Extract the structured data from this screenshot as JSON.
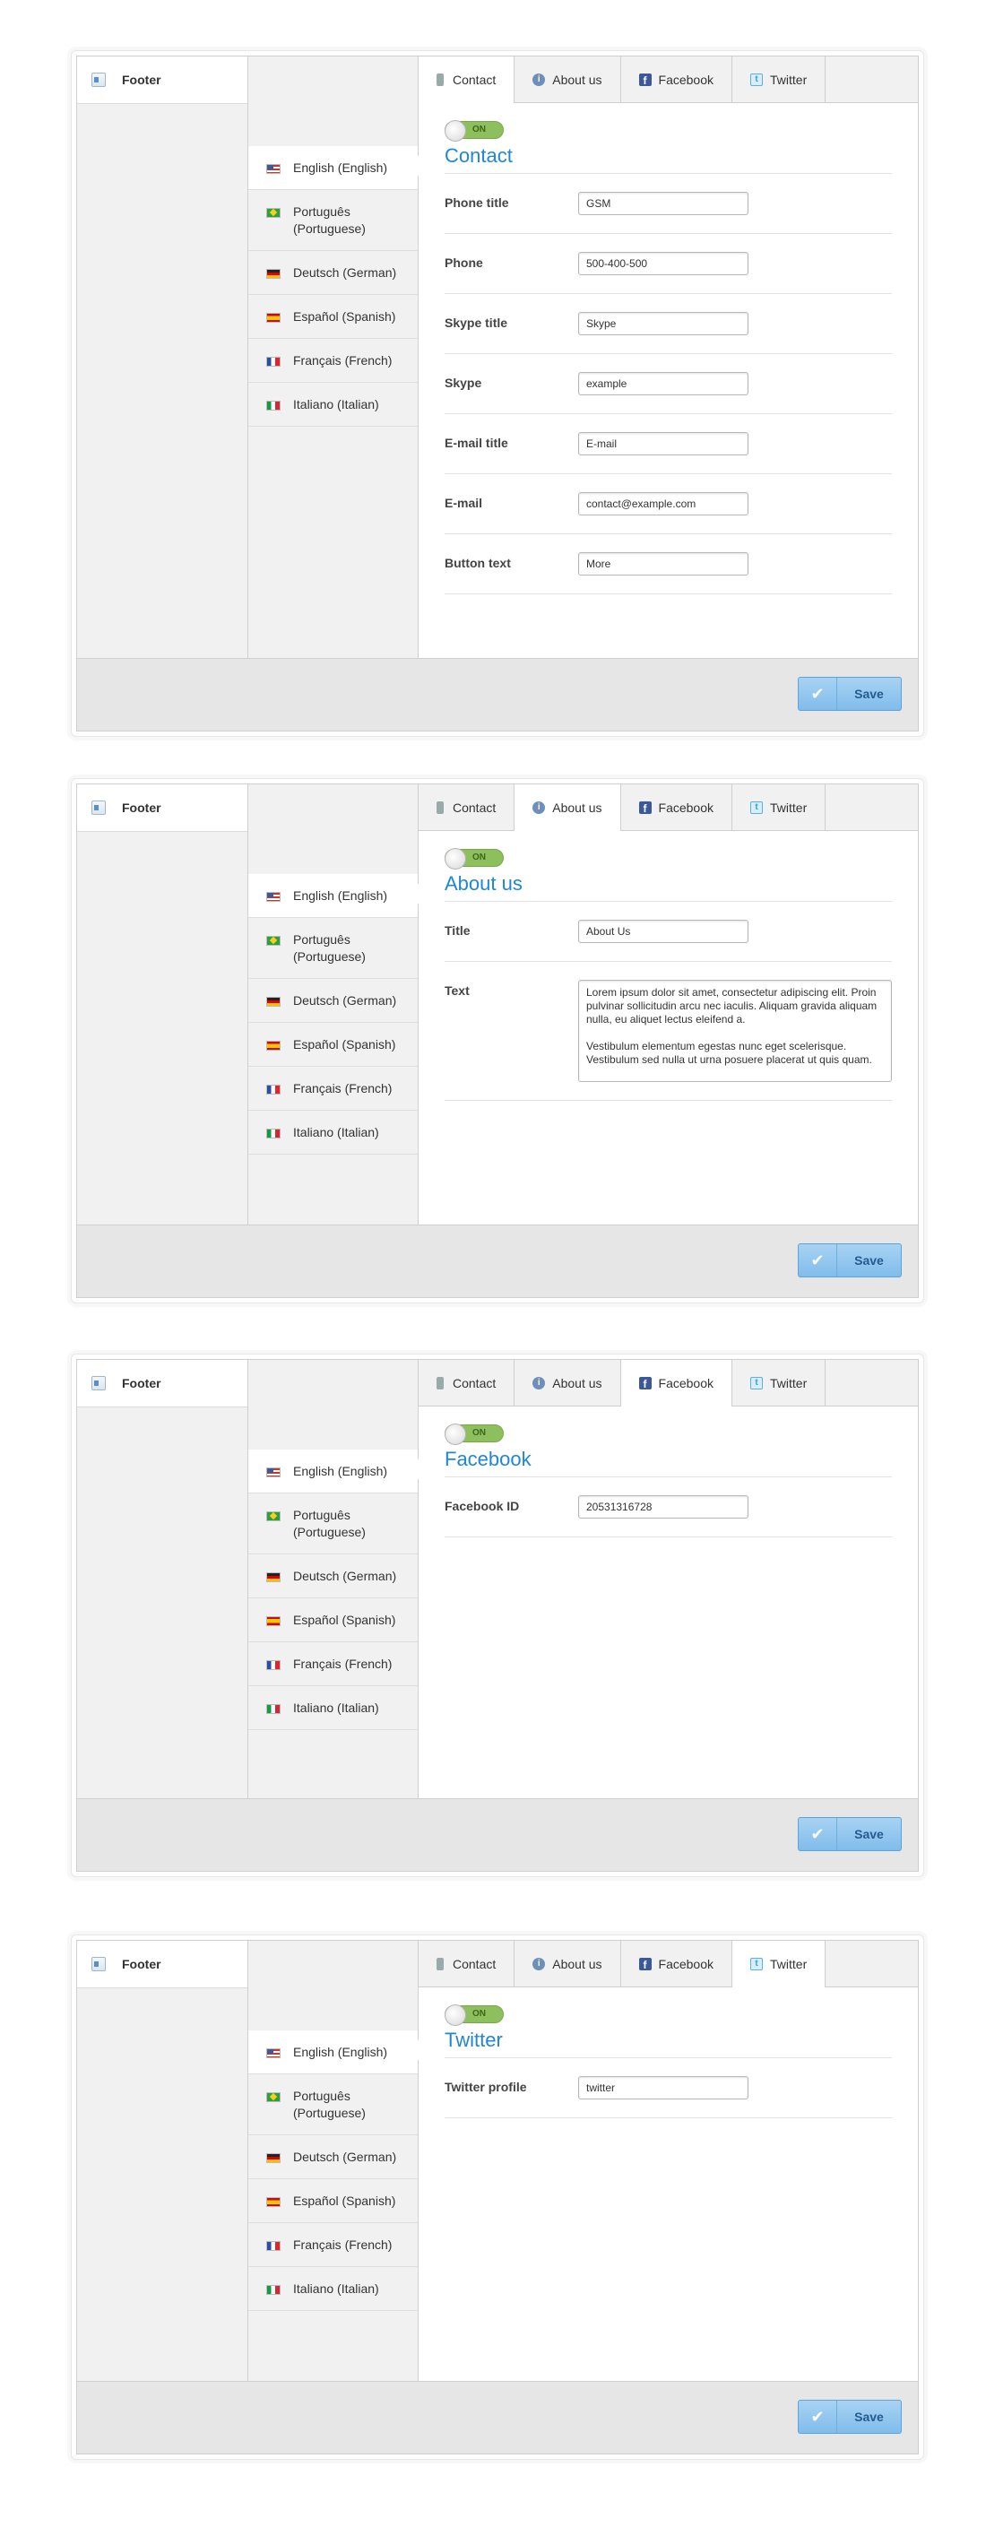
{
  "section": {
    "label": "Footer",
    "icon": "footer-module-icon"
  },
  "languages": [
    {
      "label": "English (English)",
      "flag": "flag-us"
    },
    {
      "label": "Português (Portuguese)",
      "flag": "flag-br"
    },
    {
      "label": "Deutsch (German)",
      "flag": "flag-de"
    },
    {
      "label": "Español (Spanish)",
      "flag": "flag-es"
    },
    {
      "label": "Français (French)",
      "flag": "flag-fr"
    },
    {
      "label": "Italiano (Italian)",
      "flag": "flag-it"
    }
  ],
  "tabs": [
    {
      "label": "Contact",
      "icon": "phone-icon"
    },
    {
      "label": "About us",
      "icon": "info-icon"
    },
    {
      "label": "Facebook",
      "icon": "facebook-icon"
    },
    {
      "label": "Twitter",
      "icon": "twitter-icon"
    }
  ],
  "toggle_label": "ON",
  "save_label": "Save",
  "panels": [
    {
      "active_tab": 0,
      "title": "Contact",
      "fields": [
        {
          "label": "Phone title",
          "value": "GSM"
        },
        {
          "label": "Phone",
          "value": "500-400-500"
        },
        {
          "label": "Skype title",
          "value": "Skype"
        },
        {
          "label": "Skype",
          "value": "example"
        },
        {
          "label": "E-mail title",
          "value": "E-mail"
        },
        {
          "label": "E-mail",
          "value": "contact@example.com"
        },
        {
          "label": "Button text",
          "value": "More"
        }
      ]
    },
    {
      "active_tab": 1,
      "title": "About us",
      "fields": [
        {
          "label": "Title",
          "value": "About Us"
        },
        {
          "label": "Text",
          "type": "textarea",
          "value": "Lorem ipsum dolor sit amet, consectetur adipiscing elit. Proin pulvinar sollicitudin arcu nec iaculis. Aliquam gravida aliquam nulla, eu aliquet lectus eleifend a.\n\nVestibulum elementum egestas nunc eget scelerisque. Vestibulum sed nulla ut urna posuere placerat ut quis quam."
        }
      ]
    },
    {
      "active_tab": 2,
      "title": "Facebook",
      "fields": [
        {
          "label": "Facebook ID",
          "value": "20531316728"
        }
      ]
    },
    {
      "active_tab": 3,
      "title": "Twitter",
      "fields": [
        {
          "label": "Twitter profile",
          "value": "twitter"
        }
      ]
    }
  ],
  "colors": {
    "accent": "#1f86d9",
    "toggle_on": "#8dbf5c",
    "save_button": "#80bceb"
  }
}
